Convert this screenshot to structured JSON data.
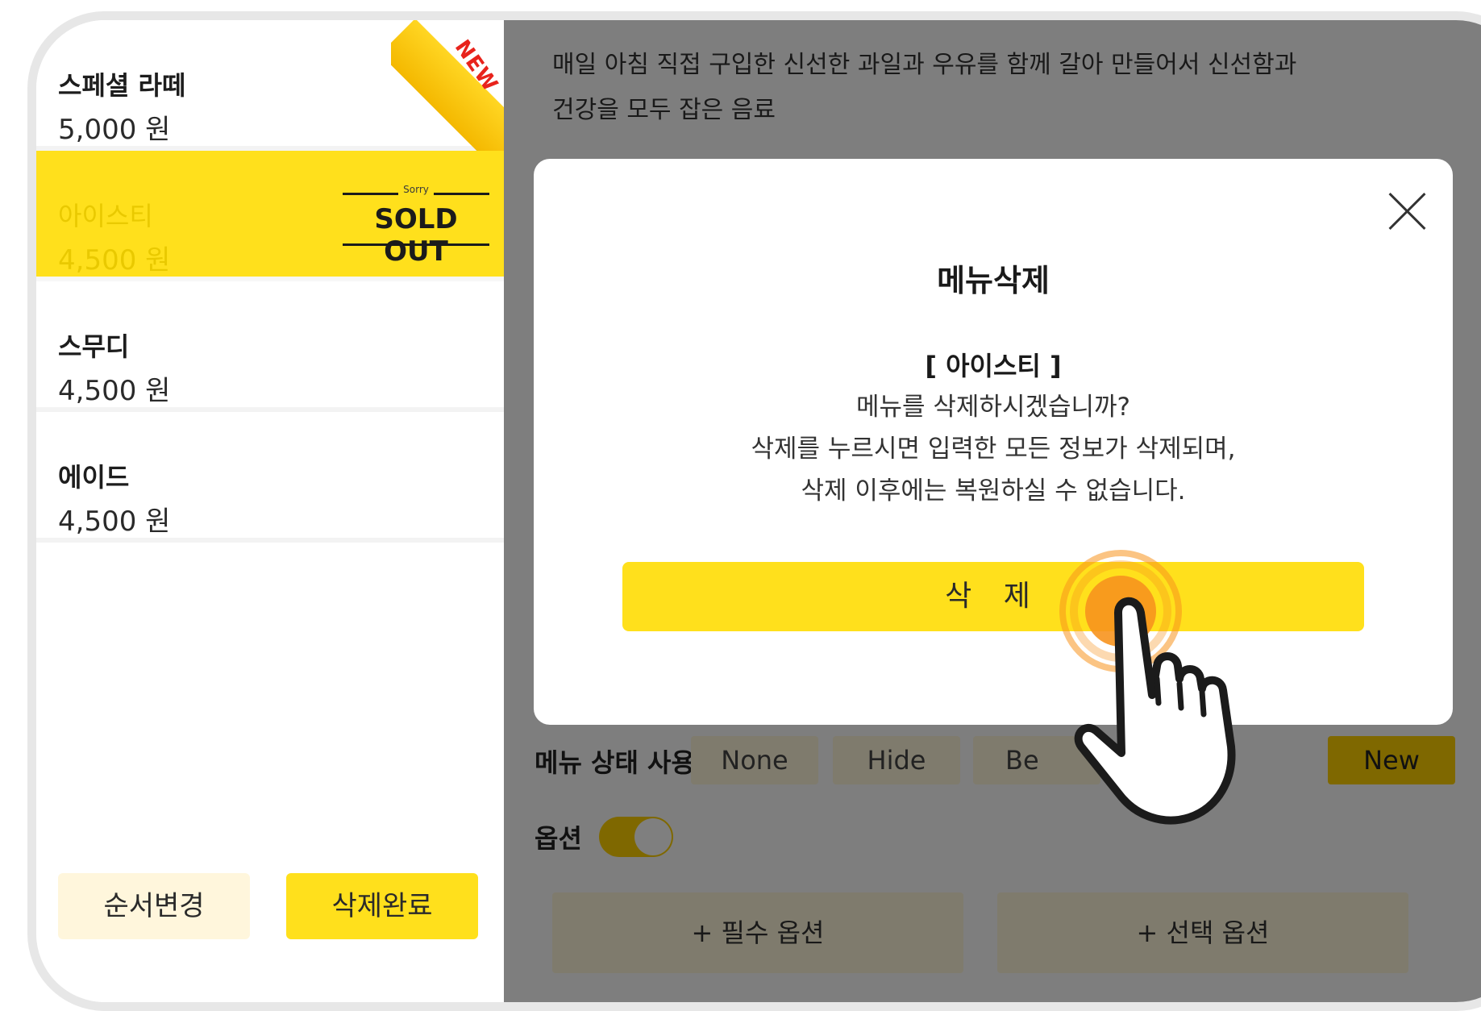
{
  "menu_list": [
    {
      "name": "스페셜 라떼",
      "price": "5,000 원",
      "badge": "NEW",
      "selected": false
    },
    {
      "name": "아이스티",
      "price": "4,500 원",
      "badge_sorry": "Sorry",
      "badge_soldout": "SOLD OUT",
      "selected": true
    },
    {
      "name": "스무디",
      "price": "4,500 원",
      "selected": false
    },
    {
      "name": "에이드",
      "price": "4,500 원",
      "selected": false
    }
  ],
  "left_buttons": {
    "reorder": "순서변경",
    "delete_done": "삭제완료"
  },
  "detail": {
    "description_line1": "매일 아침 직접 구입한 신선한 과일과 우유를 함께 갈아 만들어서 신선함과",
    "description_line2": "건강을 모두 잡은 음료",
    "status_label": "메뉴 상태 사용",
    "status_options": [
      "None",
      "Hide",
      "Be",
      "New"
    ],
    "active_status": "New",
    "option_label": "옵션",
    "option_toggle_on": true,
    "required_option": "+ 필수 옵션",
    "optional_option": "+ 선택 옵션"
  },
  "modal": {
    "title": "메뉴삭제",
    "item": "[ 아이스티 ]",
    "line1": "메뉴를 삭제하시겠습니까?",
    "line2": "삭제를 누르시면 입력한 모든 정보가 삭제되며,",
    "line3": "삭제 이후에는 복원하실 수 없습니다.",
    "delete_button": "삭 제"
  },
  "colors": {
    "accent": "#ffe01c",
    "accent_light": "#fff6dc",
    "tap_orange": "#f7931e"
  }
}
